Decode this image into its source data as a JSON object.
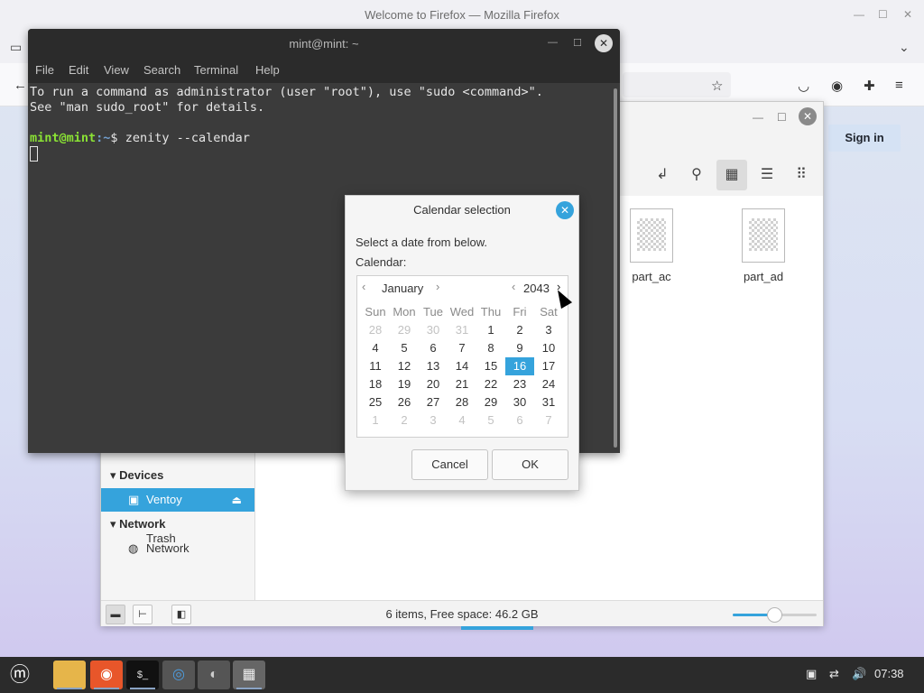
{
  "firefox": {
    "window_title": "Welcome to Firefox — Mozilla Firefox",
    "sign_in": "Sign in"
  },
  "terminal": {
    "title": "mint@mint: ~",
    "menu": [
      "File",
      "Edit",
      "View",
      "Search",
      "Terminal",
      "Help"
    ],
    "line1": "To run a command as administrator (user \"root\"), use \"sudo <command>\".",
    "line2": "See \"man sudo_root\" for details.",
    "prompt_user": "mint@mint",
    "prompt_path": ":~",
    "prompt_symbol": "$ ",
    "command": "zenity --calendar"
  },
  "file_manager": {
    "sidebar": {
      "partial_item": "Trash",
      "devices_header": "Devices",
      "ventoy": "Ventoy",
      "network_header": "Network",
      "network_item": "Network"
    },
    "files": [
      "part_ac",
      "part_ad"
    ],
    "status": "6 items, Free space: 46.2 GB",
    "zoom_level": 0.5
  },
  "calendar_dialog": {
    "title": "Calendar selection",
    "prompt": "Select a date from below.",
    "label": "Calendar:",
    "month": "January",
    "year": "2043",
    "weekdays": [
      "Sun",
      "Mon",
      "Tue",
      "Wed",
      "Thu",
      "Fri",
      "Sat"
    ],
    "weeks": [
      [
        "28",
        "29",
        "30",
        "31",
        "1",
        "2",
        "3"
      ],
      [
        "4",
        "5",
        "6",
        "7",
        "8",
        "9",
        "10"
      ],
      [
        "11",
        "12",
        "13",
        "14",
        "15",
        "16",
        "17"
      ],
      [
        "18",
        "19",
        "20",
        "21",
        "22",
        "23",
        "24"
      ],
      [
        "25",
        "26",
        "27",
        "28",
        "29",
        "30",
        "31"
      ],
      [
        "1",
        "2",
        "3",
        "4",
        "5",
        "6",
        "7"
      ]
    ],
    "selected_day": "16",
    "cancel": "Cancel",
    "ok": "OK"
  },
  "taskbar": {
    "clock": "07:38"
  },
  "colors": {
    "accent": "#35a3dc",
    "terminal_bg": "#3b3b3b",
    "prompt_green": "#8ae234",
    "prompt_blue": "#729fcf"
  }
}
